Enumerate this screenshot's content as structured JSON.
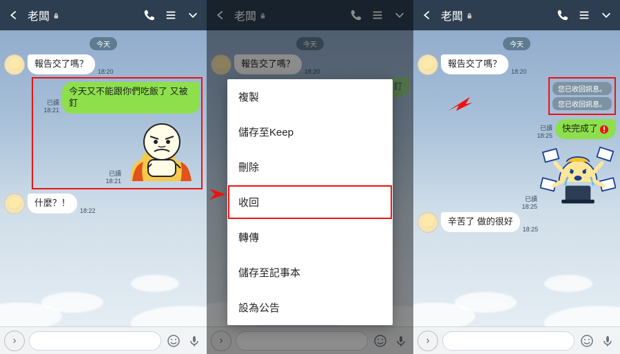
{
  "header": {
    "title": "老闆",
    "lock": "🔒",
    "icons": {
      "call": "call-icon",
      "list": "list-icon",
      "chevron": "chevron-down-icon"
    }
  },
  "date_label": "今天",
  "screens": {
    "s1": {
      "in1": {
        "text": "報告交了嗎？",
        "time": "18:20"
      },
      "out1": {
        "text": "今天又不能跟你們吃飯了 又被釘",
        "read": "已讀",
        "time": "18:21"
      },
      "sticker_meta": {
        "read": "已讀",
        "time": "18:21"
      },
      "in2": {
        "text": "什麼？！",
        "time": "18:22"
      }
    },
    "s2": {
      "in1": {
        "text": "報告交了嗎？",
        "time": "18:20"
      },
      "out_partial": "釘",
      "menu": {
        "copy": "複製",
        "keep": "儲存至Keep",
        "delete": "刪除",
        "unsend": "收回",
        "forward": "轉傳",
        "note": "儲存至記事本",
        "announce": "設為公告"
      }
    },
    "s3": {
      "in1": {
        "text": "報告交了嗎？",
        "time": "18:20"
      },
      "recall1": "您已收回訊息。",
      "recall2": "您已收回訊息。",
      "out1": {
        "text": "快完成了",
        "read": "已讀",
        "time": "18:25"
      },
      "sticker_meta": {
        "read": "已讀",
        "time": "18:25"
      },
      "in2": {
        "text": "辛苦了 做的很好",
        "time": "18:25"
      }
    }
  },
  "footer": {
    "chev": "›"
  }
}
